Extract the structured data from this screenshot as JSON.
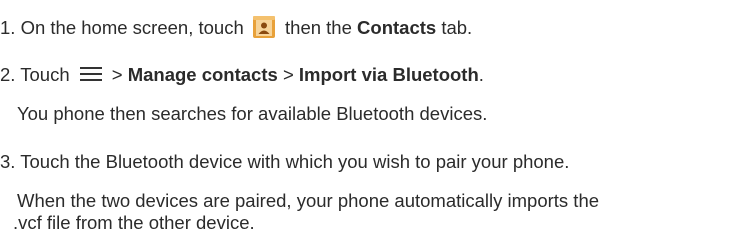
{
  "steps": [
    {
      "number": "1.",
      "text_before": " On the home screen, touch ",
      "text_middle": " then the ",
      "bold": "Contacts",
      "text_after": " tab.",
      "icon": "contacts-app-icon"
    },
    {
      "number": "2.",
      "text_before": " Touch ",
      "icon": "menu-icon",
      "sep1": "> ",
      "bold1": "Manage contacts",
      "sep2": " > ",
      "bold2": "Import via Bluetooth",
      "text_after": "."
    },
    {
      "note": "You phone then searches for available Bluetooth devices."
    },
    {
      "number": "3.",
      "text": " Touch the Bluetooth device with which you wish to pair your phone."
    },
    {
      "note_line1": "When the two devices are paired, your phone automatically imports the",
      "note_line2": ".vcf file from the other device."
    }
  ],
  "colors": {
    "text": "#2b2b2b",
    "icon_orange": "#e8a13a",
    "icon_dark": "#8a4a10"
  }
}
